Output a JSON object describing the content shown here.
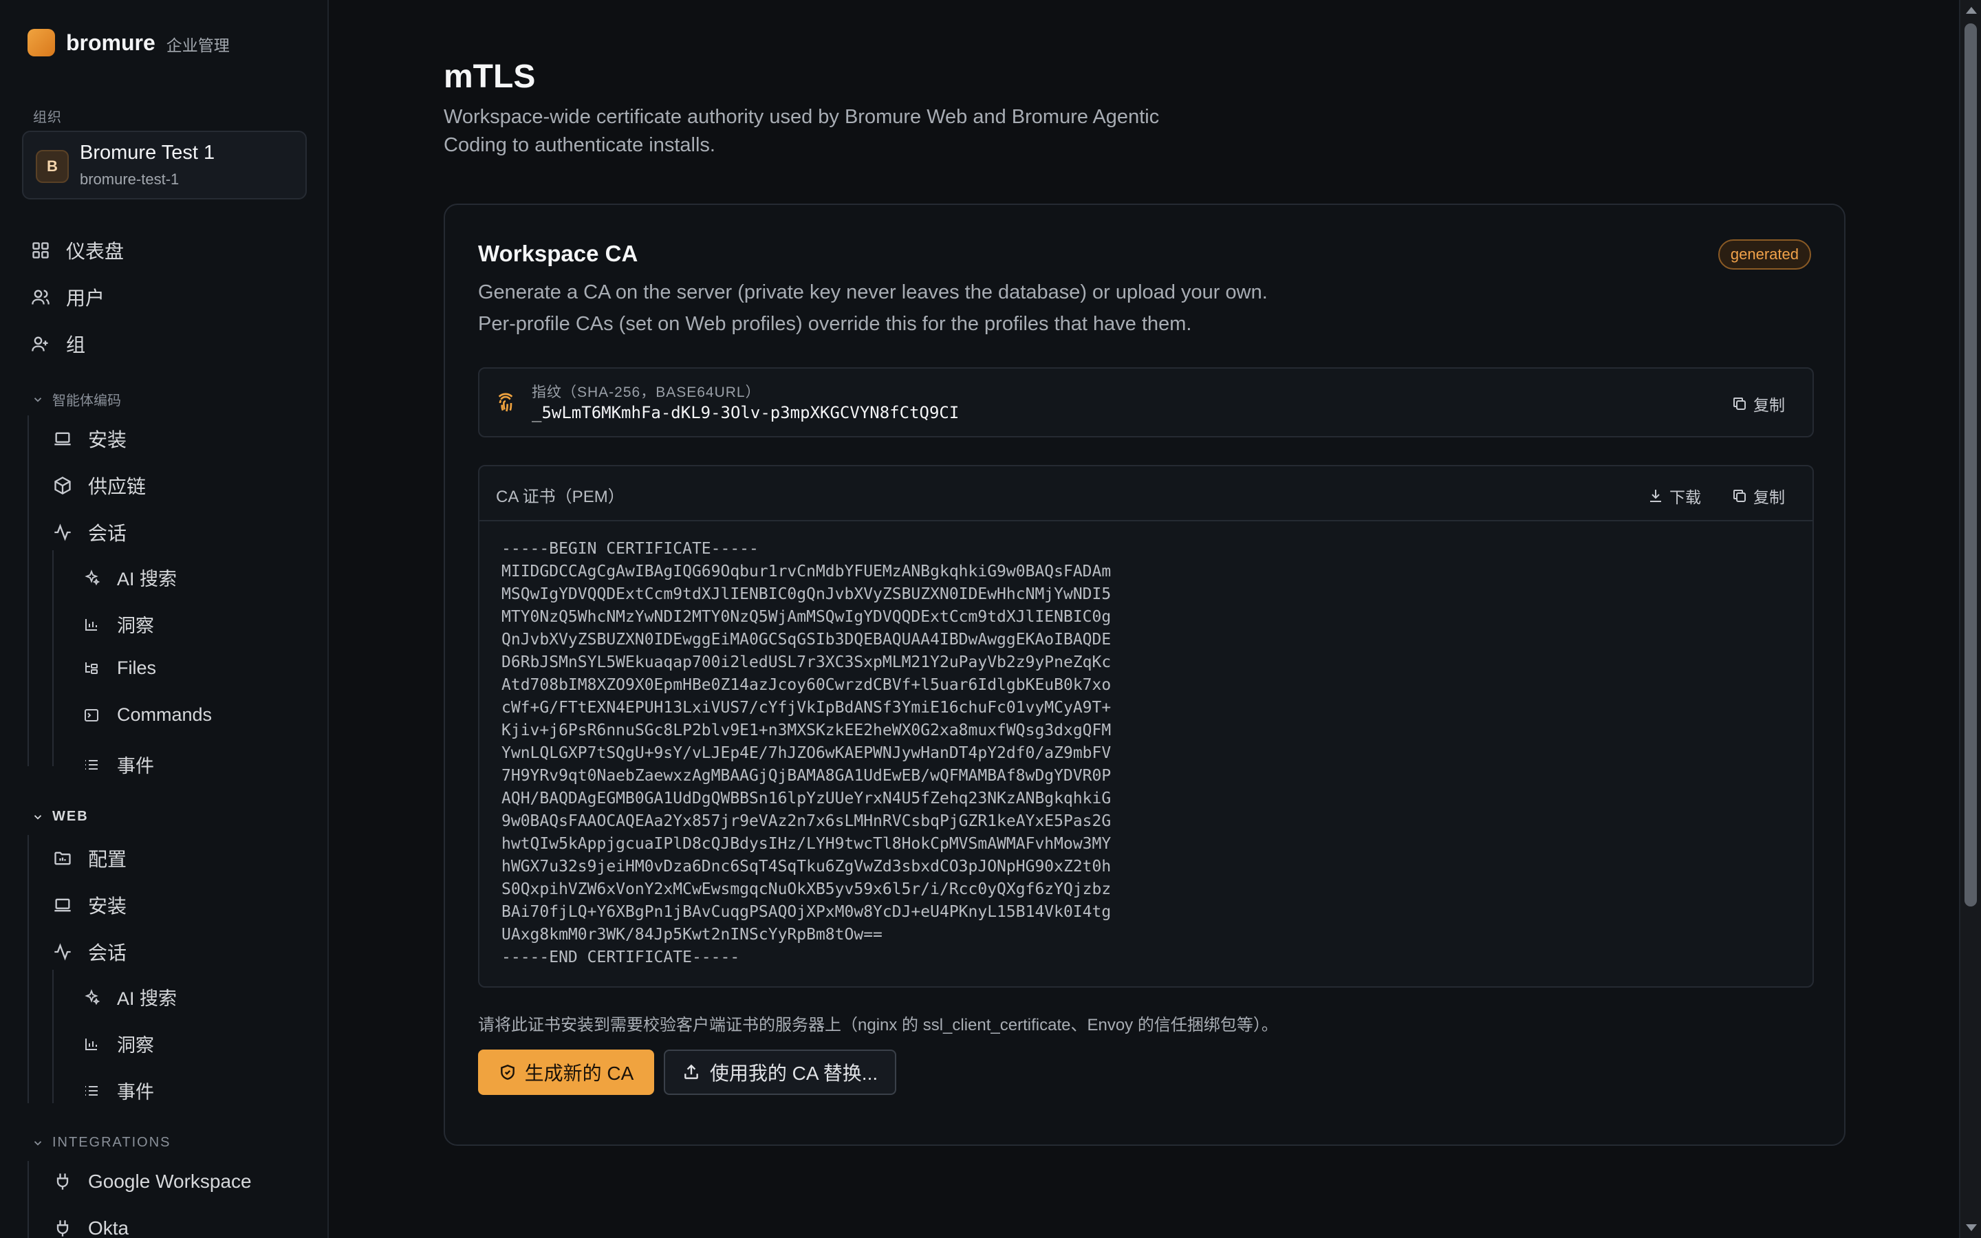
{
  "brand": {
    "name": "bromure",
    "subtitle": "企业管理"
  },
  "sidebar": {
    "org_section_label": "组织",
    "org": {
      "initial": "B",
      "name": "Bromure Test 1",
      "slug": "bromure-test-1"
    },
    "top_items": [
      {
        "label": "仪表盘",
        "icon": "dashboard-icon"
      },
      {
        "label": "用户",
        "icon": "user-icon"
      },
      {
        "label": "组",
        "icon": "users-icon"
      }
    ],
    "agentic_group": {
      "label": "智能体编码",
      "items": [
        {
          "label": "安装",
          "icon": "laptop-icon"
        },
        {
          "label": "供应链",
          "icon": "package-icon"
        },
        {
          "label": "会话",
          "icon": "activity-icon"
        }
      ],
      "session_sub": [
        {
          "label": "AI 搜索",
          "icon": "sparkles-icon"
        },
        {
          "label": "洞察",
          "icon": "bar-chart-icon"
        },
        {
          "label": "Files",
          "icon": "folder-tree-icon"
        },
        {
          "label": "Commands",
          "icon": "terminal-icon"
        },
        {
          "label": "事件",
          "icon": "list-icon"
        }
      ]
    },
    "web_group": {
      "label": "WEB",
      "items": [
        {
          "label": "配置",
          "icon": "folder-settings-icon"
        },
        {
          "label": "安装",
          "icon": "laptop-icon"
        },
        {
          "label": "会话",
          "icon": "activity-icon"
        }
      ],
      "session_sub": [
        {
          "label": "AI 搜索",
          "icon": "sparkles-icon"
        },
        {
          "label": "洞察",
          "icon": "bar-chart-icon"
        },
        {
          "label": "事件",
          "icon": "list-icon"
        }
      ]
    },
    "integrations_group": {
      "label": "INTEGRATIONS",
      "items": [
        {
          "label": "Google Workspace",
          "icon": "plug-icon"
        },
        {
          "label": "Okta",
          "icon": "plug-icon"
        }
      ]
    }
  },
  "main": {
    "title": "mTLS",
    "description": "Workspace-wide certificate authority used by Bromure Web and Bromure Agentic Coding to authenticate installs.",
    "card": {
      "title": "Workspace CA",
      "badge": "generated",
      "description": "Generate a CA on the server (private key never leaves the database) or upload your own. Per-profile CAs (set on Web profiles) override this for the profiles that have them.",
      "fingerprint_label": "指纹（SHA-256，BASE64URL）",
      "fingerprint_value": "_5wLmT6MKmhFa-dKL9-3Olv-p3mpXKGCVYN8fCtQ9CI",
      "copy_label": "复制",
      "pem_title": "CA 证书（PEM）",
      "download_label": "下载",
      "pem_lines": [
        "-----BEGIN CERTIFICATE-----",
        "MIIDGDCCAgCgAwIBAgIQG69Oqbur1rvCnMdbYFUEMzANBgkqhkiG9w0BAQsFADAm",
        "MSQwIgYDVQQDExtCcm9tdXJlIENBIC0gQnJvbXVyZSBUZXN0IDEwHhcNMjYwNDI5",
        "MTY0NzQ5WhcNMzYwNDI2MTY0NzQ5WjAmMSQwIgYDVQQDExtCcm9tdXJlIENBIC0g",
        "QnJvbXVyZSBUZXN0IDEwggEiMA0GCSqGSIb3DQEBAQUAA4IBDwAwggEKAoIBAQDE",
        "D6RbJSMnSYL5WEkuaqap700i2ledUSL7r3XC3SxpMLM21Y2uPayVb2z9yPneZqKc",
        "Atd708bIM8XZO9X0EpmHBe0Z14azJcoy60CwrzdCBVf+l5uar6IdlgbKEuB0k7xo",
        "cWf+G/FTtEXN4EPUH13LxiVUS7/cYfjVkIpBdANSf3YmiE16chuFc01vyMCyA9T+",
        "Kjiv+j6PsR6nnuSGc8LP2blv9E1+n3MXSKzkEE2heWX0G2xa8muxfWQsg3dxgQFM",
        "YwnLQLGXP7tSQgU+9sY/vLJEp4E/7hJZO6wKAEPWNJywHanDT4pY2df0/aZ9mbFV",
        "7H9YRv9qt0NaebZaewxzAgMBAAGjQjBAMA8GA1UdEwEB/wQFMAMBAf8wDgYDVR0P",
        "AQH/BAQDAgEGMB0GA1UdDgQWBBSn16lpYzUUeYrxN4U5fZehq23NKzANBgkqhkiG",
        "9w0BAQsFAAOCAQEAa2Yx857jr9eVAz2n7x6sLMHnRVCsbqPjGZR1keAYxE5Pas2G",
        "hwtQIw5kAppjgcuaIPlD8cQJBdysIHz/LYH9twcTl8HokCpMVSmAWMAFvhMow3MY",
        "hWGX7u32s9jeiHM0vDza6Dnc6SqT4SqTku6ZgVwZd3sbxdCO3pJONpHG90xZ2t0h",
        "S0QxpihVZW6xVonY2xMCwEwsmgqcNuOkXB5yv59x6l5r/i/Rcc0yQXgf6zYQjzbz",
        "BAi70fjLQ+Y6XBgPn1jBAvCuqgPSAQOjXPxM0w8YcDJ+eU4PKnyL15B14Vk0I4tg",
        "UAxg8kmM0r3WK/84Jp5Kwt2nINScYyRpBm8tOw==",
        "-----END CERTIFICATE-----"
      ],
      "hint": "请将此证书安装到需要校验客户端证书的服务器上（nginx 的 ssl_client_certificate、Envoy 的信任捆绑包等）。",
      "generate_label": "生成新的 CA",
      "replace_label": "使用我的 CA 替换..."
    }
  },
  "colors": {
    "accent": "#f0a33f",
    "background": "#0d0f12",
    "card": "#0f1216"
  }
}
